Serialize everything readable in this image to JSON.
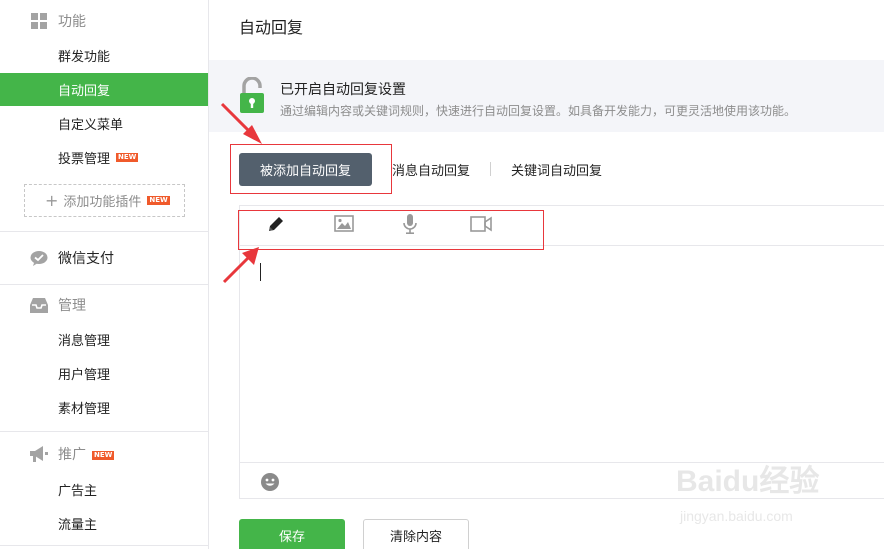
{
  "sidebar": {
    "features": {
      "title": "功能",
      "icon": "grid-icon",
      "items": [
        {
          "label": "群发功能"
        },
        {
          "label": "自动回复",
          "active": true
        },
        {
          "label": "自定义菜单"
        },
        {
          "label": "投票管理",
          "badge": "NEW"
        }
      ],
      "add_plugin_label": "添加功能插件",
      "add_plugin_badge": "NEW"
    },
    "payment": {
      "title": "微信支付",
      "icon": "wechat-pay-icon"
    },
    "management": {
      "title": "管理",
      "icon": "inbox-icon",
      "items": [
        {
          "label": "消息管理"
        },
        {
          "label": "用户管理"
        },
        {
          "label": "素材管理"
        }
      ]
    },
    "promotion": {
      "title": "推广",
      "icon": "megaphone-icon",
      "badge": "NEW",
      "items": [
        {
          "label": "广告主"
        },
        {
          "label": "流量主"
        }
      ]
    }
  },
  "main": {
    "title": "自动回复",
    "notice": {
      "title": "已开启自动回复设置",
      "description": "通过编辑内容或关键词规则，快速进行自动回复设置。如具备开发能力，可更灵活地使用该功能。"
    },
    "tabs": [
      {
        "label": "被添加自动回复",
        "active": true
      },
      {
        "label": "消息自动回复"
      },
      {
        "label": "关键词自动回复"
      }
    ],
    "editor": {
      "tools": [
        "pencil-icon",
        "image-icon",
        "microphone-icon",
        "video-icon"
      ],
      "content": ""
    },
    "buttons": {
      "save": "保存",
      "clear": "清除内容"
    }
  },
  "watermark": {
    "logo": "Baidu经验",
    "url": "jingyan.baidu.com"
  },
  "colors": {
    "accent_green": "#44b549",
    "tab_active_bg": "#53606d",
    "badge_orange": "#f05a2b",
    "annotation_red": "#e8373c"
  }
}
